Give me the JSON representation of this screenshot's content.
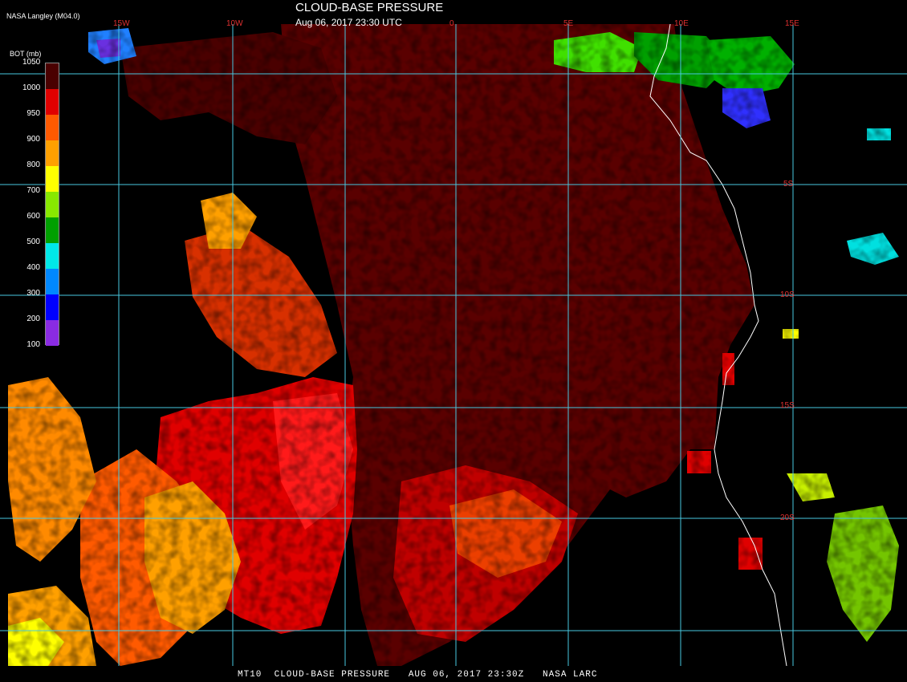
{
  "header": {
    "title": "CLOUD-BASE PRESSURE",
    "subtitle": "Aug 06, 2017 23:30 UTC",
    "provider": "NASA Langley (M04.0)"
  },
  "legend": {
    "unit_label": "BOT (mb)",
    "levels": [
      "1050",
      "1000",
      "950",
      "900",
      "800",
      "700",
      "600",
      "500",
      "400",
      "300",
      "200",
      "100"
    ],
    "colors": [
      "#4a0000",
      "#e00000",
      "#ff5a00",
      "#ffa000",
      "#ffff00",
      "#88e800",
      "#00a000",
      "#00e8e8",
      "#0088ff",
      "#0000ff",
      "#8a2be2"
    ]
  },
  "grid": {
    "line_color": "#48c8e0",
    "lon_labels": [
      "15W",
      "10W",
      "0",
      "5E",
      "10E",
      "15E"
    ],
    "lat_labels": [
      "5S",
      "10S",
      "15S",
      "20S"
    ]
  },
  "footer": {
    "text": "MT10  CLOUD-BASE PRESSURE   AUG 06, 2017 23:30Z   NASA LARC"
  }
}
